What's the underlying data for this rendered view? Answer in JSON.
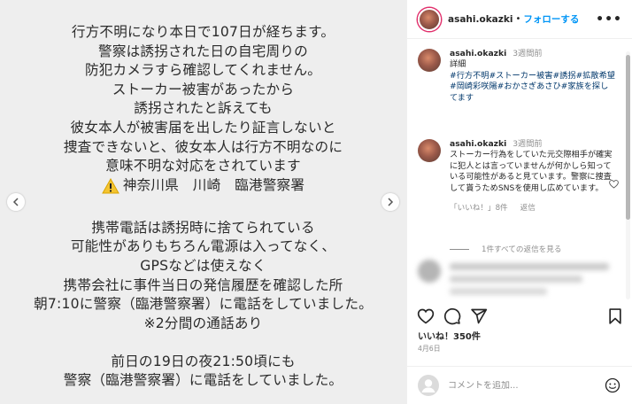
{
  "post": {
    "lines": [
      "行方不明になり本日で107日が経ちます。",
      "警察は誘拐された日の自宅周りの",
      "防犯カメラすら確認してくれません。",
      "ストーカー被害があったから",
      "誘拐されたと訴えても",
      "彼女本人が被害届を出したり証言しないと",
      "捜査できないと、彼女本人は行方不明なのに",
      "意味不明な対応をされています",
      "神奈川県　川崎　臨港警察署",
      "",
      "携帯電話は誘拐時に捨てられている",
      "可能性がありもちろん電源は入ってなく、",
      "GPSなどは使えなく",
      "携帯会社に事件当日の発信履歴を確認した所",
      "朝7:10に警察（臨港警察署）に電話をしていました。",
      "※2分間の通話あり",
      "",
      "前日の19日の夜21:50頃にも",
      "警察（臨港警察署）に電話をしていました。"
    ],
    "warning_icon": "warning-icon"
  },
  "header": {
    "username": "asahi.okazki",
    "separator": "•",
    "follow_label": "フォローする",
    "more_icon": "more-icon"
  },
  "comments": [
    {
      "username": "asahi.okazki",
      "time": "3週間前",
      "text": "詳細",
      "tags": "#行方不明#ストーカー被害#誘拐#拡散希望#岡崎彩咲陽#おかさぎあさひ#家族を探してます"
    },
    {
      "username": "asahi.okazki",
      "time": "3週間前",
      "text": "ストーカー行為をしていた元交際相手が確実に犯人とは言っていませんが何かしら知っている可能性があると見ています。警察に捜査して貰うためSNSを使用し広めています。",
      "likes_label": "「いいね！」8件",
      "reply_label": "返信",
      "view_replies_label": "1件すべての返信を見る"
    }
  ],
  "actions": {
    "likes": "いいね！350件",
    "date": "4月6日"
  },
  "comment_input": {
    "placeholder": "コメントを追加..."
  },
  "colors": {
    "accent": "#0095f6",
    "tag": "#00376b",
    "muted": "#8e8e8e",
    "image_bg": "#eeeeee"
  }
}
